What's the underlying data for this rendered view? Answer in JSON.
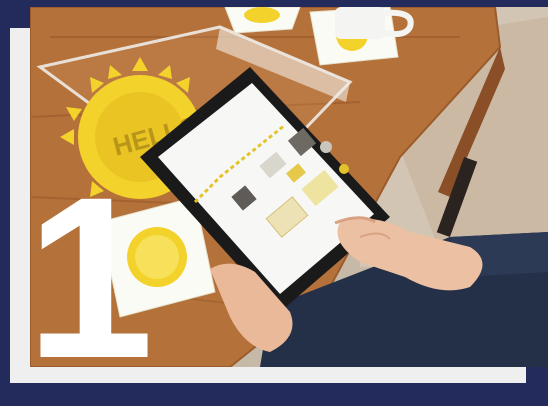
{
  "slide": {
    "step_number": "1"
  },
  "photo": {
    "subject": "hands-holding-tablet-over-table",
    "props": [
      "hello-sun-acrylic-tray",
      "sun-coasters",
      "white-mug",
      "tablet"
    ]
  },
  "colors": {
    "navy_border": "#232a5c",
    "panel": "#efefef",
    "table_wood": "#b5713a",
    "sun_yellow": "#f3d22c",
    "tablet_black": "#1a1a1a",
    "screen_white": "#f7f7f5",
    "jeans": "#233048"
  }
}
